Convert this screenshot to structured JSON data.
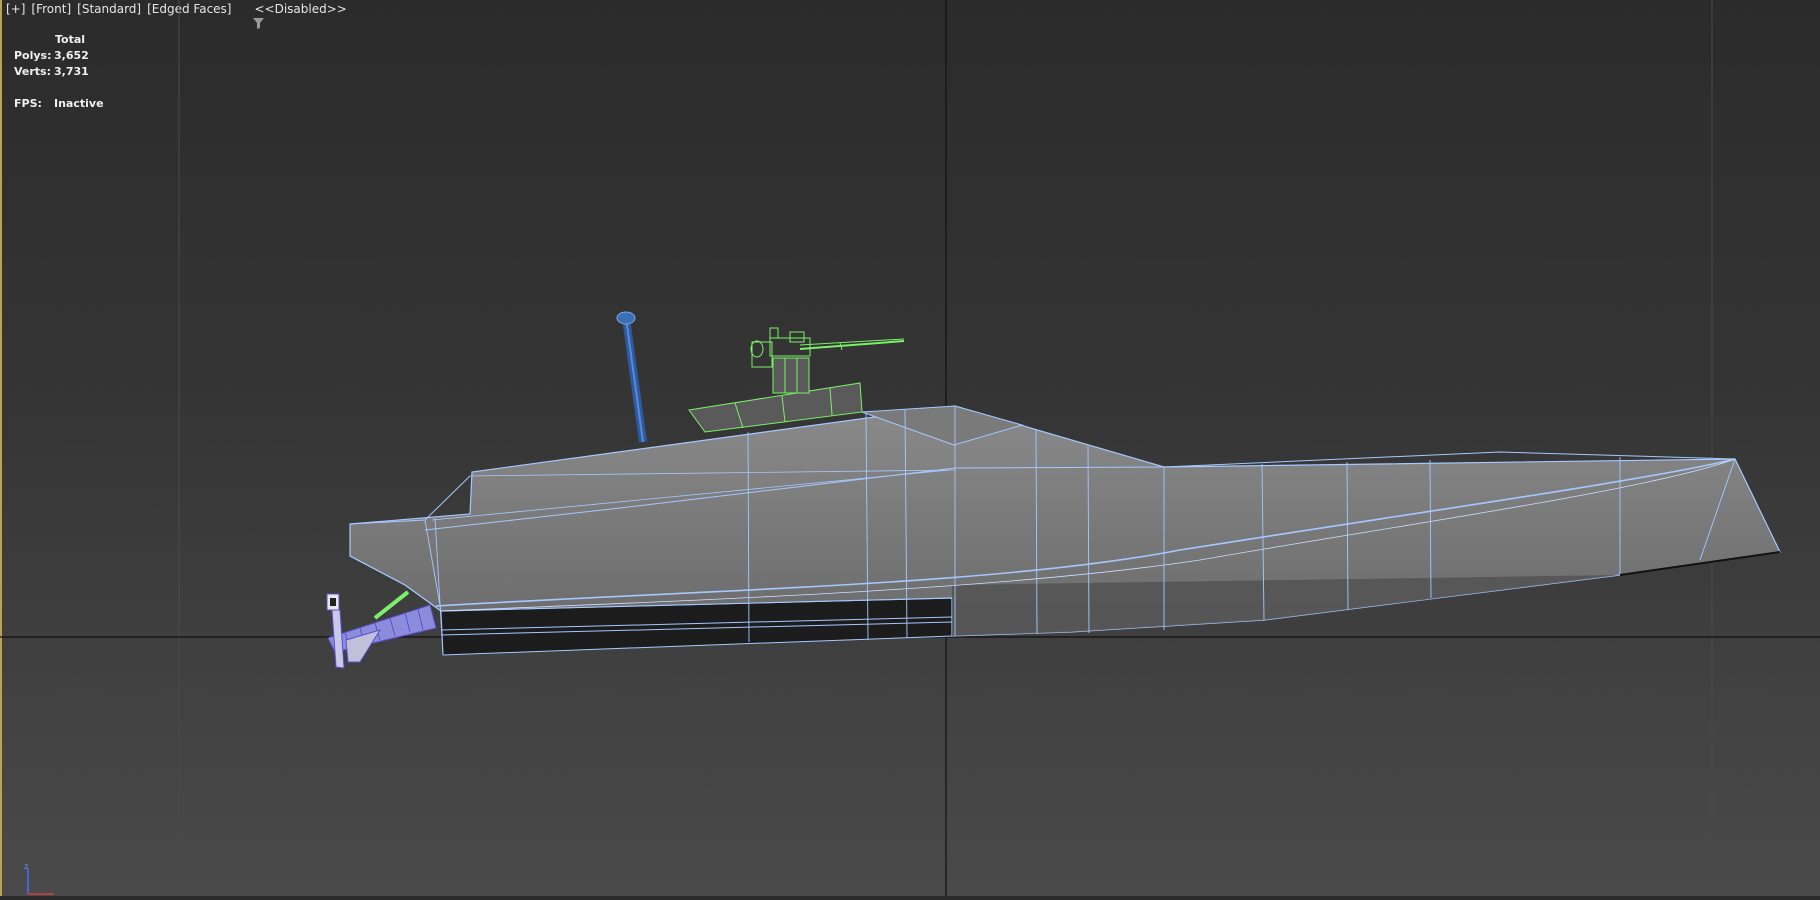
{
  "viewport": {
    "label_plus": "[+]",
    "label_view": "[Front]",
    "label_shading": "[Standard]",
    "label_edges": "[Edged Faces]",
    "label_filter": "<<Disabled>>"
  },
  "stats": {
    "header": "Total",
    "polys_label": "Polys:",
    "polys_value": "3,652",
    "verts_label": "Verts:",
    "verts_value": "3,731",
    "fps_label": "FPS:",
    "fps_value": "Inactive"
  },
  "icons": {
    "filter": "funnel-icon",
    "gizmo": "axis-tripod-icon"
  },
  "colors": {
    "border_active": "#b9a64a",
    "hull_wire": "#a6c8ff",
    "gun_wire": "#7cf06a",
    "mast": "#3a6fb8",
    "propeller": "#6a5cd6"
  }
}
